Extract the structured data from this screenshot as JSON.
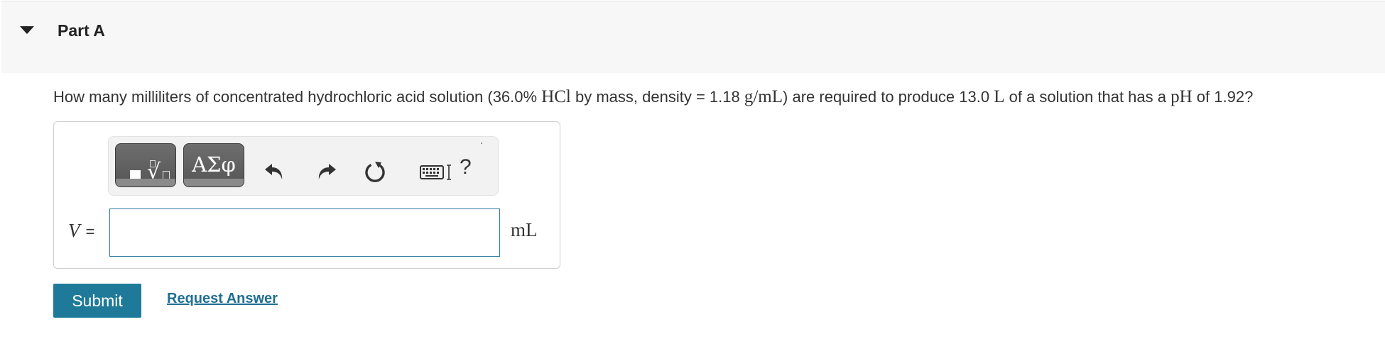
{
  "part": {
    "title": "Part A",
    "toggle_icon": "caret-down-icon"
  },
  "question": {
    "text_1": "How many milliliters of concentrated hydrochloric acid solution (36.0% ",
    "math_1": "HCl",
    "text_2": " by mass, density = 1.18 ",
    "math_2": "g/mL",
    "text_3": ") are required to produce 13.0 ",
    "math_3": "L",
    "text_4": " of a solution that has a ",
    "math_4": "pH",
    "text_5": " of 1.92?"
  },
  "toolbar": {
    "templates_icon": "templates-icon",
    "symbols_label": "ΑΣφ",
    "undo_icon": "undo-icon",
    "redo_icon": "redo-icon",
    "reset_icon": "reset-icon",
    "keyboard_icon": "keyboard-icon",
    "help_label": "?"
  },
  "answer": {
    "variable": "V",
    "equals": "=",
    "value": "",
    "unit": "mL"
  },
  "actions": {
    "submit_label": "Submit",
    "request_answer_label": "Request Answer"
  },
  "colors": {
    "accent": "#1f7a99",
    "link": "#1f6f92",
    "header_bg": "#f7f7f7",
    "tool_button": "#5f5f5f"
  }
}
